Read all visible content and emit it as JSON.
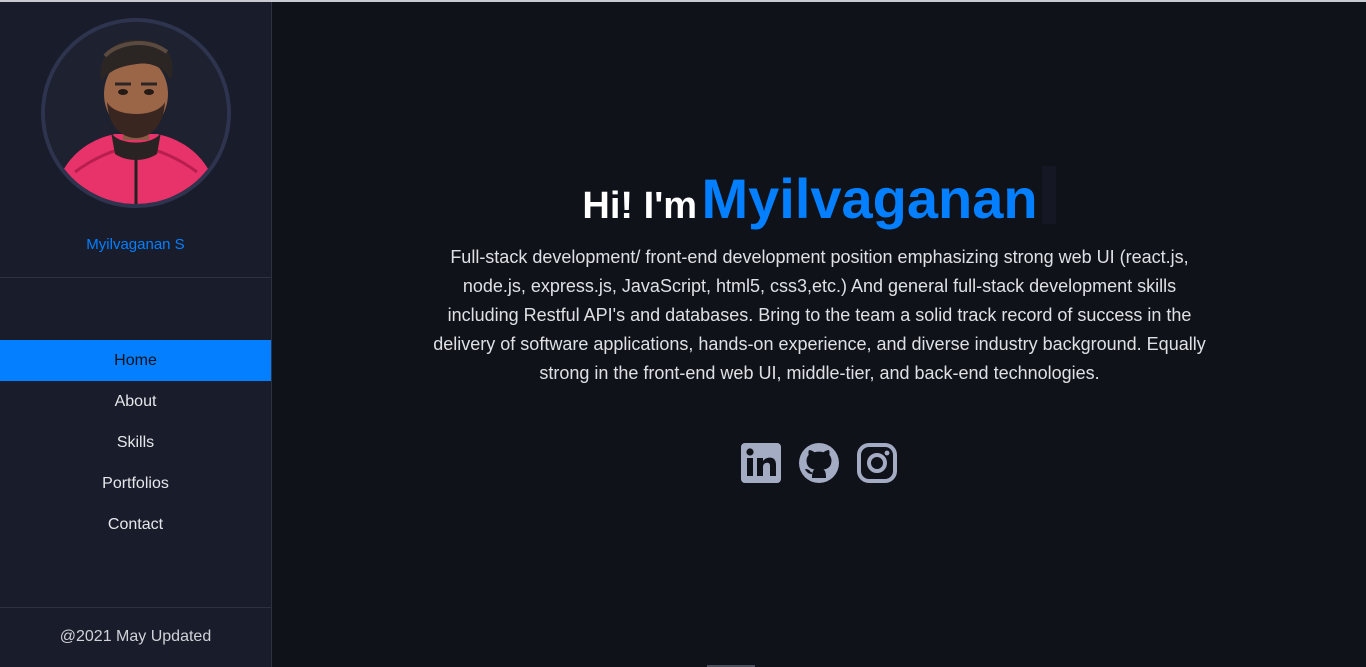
{
  "sidebar": {
    "profile_name": "Myilvaganan S",
    "nav": [
      {
        "label": "Home",
        "active": true
      },
      {
        "label": "About",
        "active": false
      },
      {
        "label": "Skills",
        "active": false
      },
      {
        "label": "Portfolios",
        "active": false
      },
      {
        "label": "Contact",
        "active": false
      }
    ],
    "footer": "@2021 May Updated"
  },
  "hero": {
    "greeting": "Hi! I'm",
    "name": "Myilvaganan",
    "description": "Full-stack development/ front-end development position emphasizing strong web UI (react.js, node.js, express.js, JavaScript, html5, css3,etc.) And general full-stack development skills including Restful API's and databases. Bring to the team a solid track record of success in the delivery of software applications, hands-on experience, and diverse industry background. Equally strong in the front-end web UI, middle-tier, and back-end technologies."
  },
  "socials": [
    {
      "icon": "linkedin-icon"
    },
    {
      "icon": "github-icon"
    },
    {
      "icon": "instagram-icon"
    }
  ],
  "colors": {
    "accent": "#037fff",
    "sidebar_bg": "#191d2b",
    "main_bg": "#10121a",
    "icon": "#a4acc4"
  }
}
